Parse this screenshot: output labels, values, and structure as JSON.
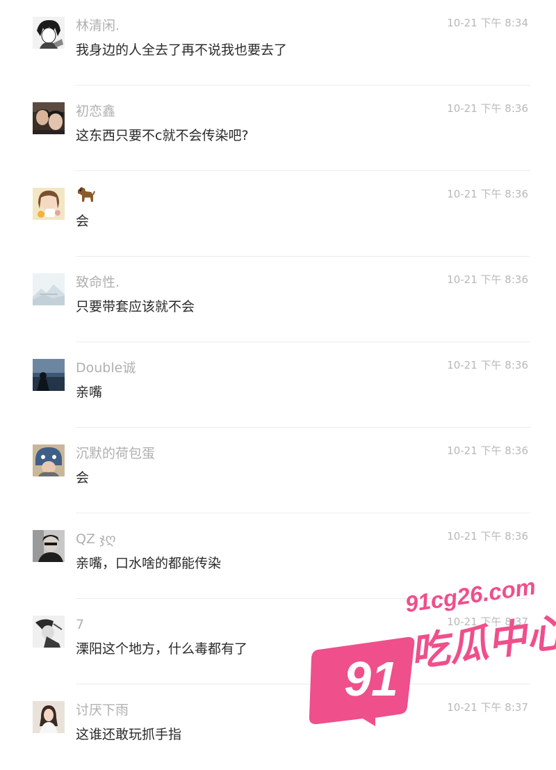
{
  "comments": [
    {
      "username": "林清闲.",
      "time": "10-21 下午 8:34",
      "text": "我身边的人全去了再不说我也要去了",
      "avatar_icon": "avatar-icon"
    },
    {
      "username": "初恋鑫",
      "time": "10-21 下午 8:36",
      "text": "这东西只要不c就不会传染吧?",
      "avatar_icon": "avatar-icon"
    },
    {
      "username": "",
      "username_icon": "dog-icon",
      "time": "10-21 下午 8:36",
      "text": "会",
      "avatar_icon": "avatar-icon"
    },
    {
      "username": "致命性.",
      "time": "10-21 下午 8:36",
      "text": "只要带套应该就不会",
      "avatar_icon": "avatar-icon"
    },
    {
      "username": "Double诚",
      "time": "10-21 下午 8:36",
      "text": "亲嘴",
      "avatar_icon": "avatar-icon"
    },
    {
      "username": "沉默的荷包蛋",
      "time": "10-21 下午 8:36",
      "text": "会",
      "avatar_icon": "avatar-icon"
    },
    {
      "username": "QZ ჯღ",
      "time": "10-21 下午 8:36",
      "text": "亲嘴，口水啥的都能传染",
      "avatar_icon": "avatar-icon"
    },
    {
      "username": "7",
      "time": "10-21 下午 8:37",
      "text": "溧阳这个地方，什么毒都有了",
      "avatar_icon": "avatar-icon"
    },
    {
      "username": "讨厌下雨",
      "time": "10-21 下午 8:37",
      "text": "这谁还敢玩抓手指",
      "avatar_icon": "avatar-icon"
    }
  ],
  "watermark": {
    "number": "91",
    "domain": "91cg26.com",
    "brand": "吃瓜中心",
    "color": "#ef4f8b"
  }
}
